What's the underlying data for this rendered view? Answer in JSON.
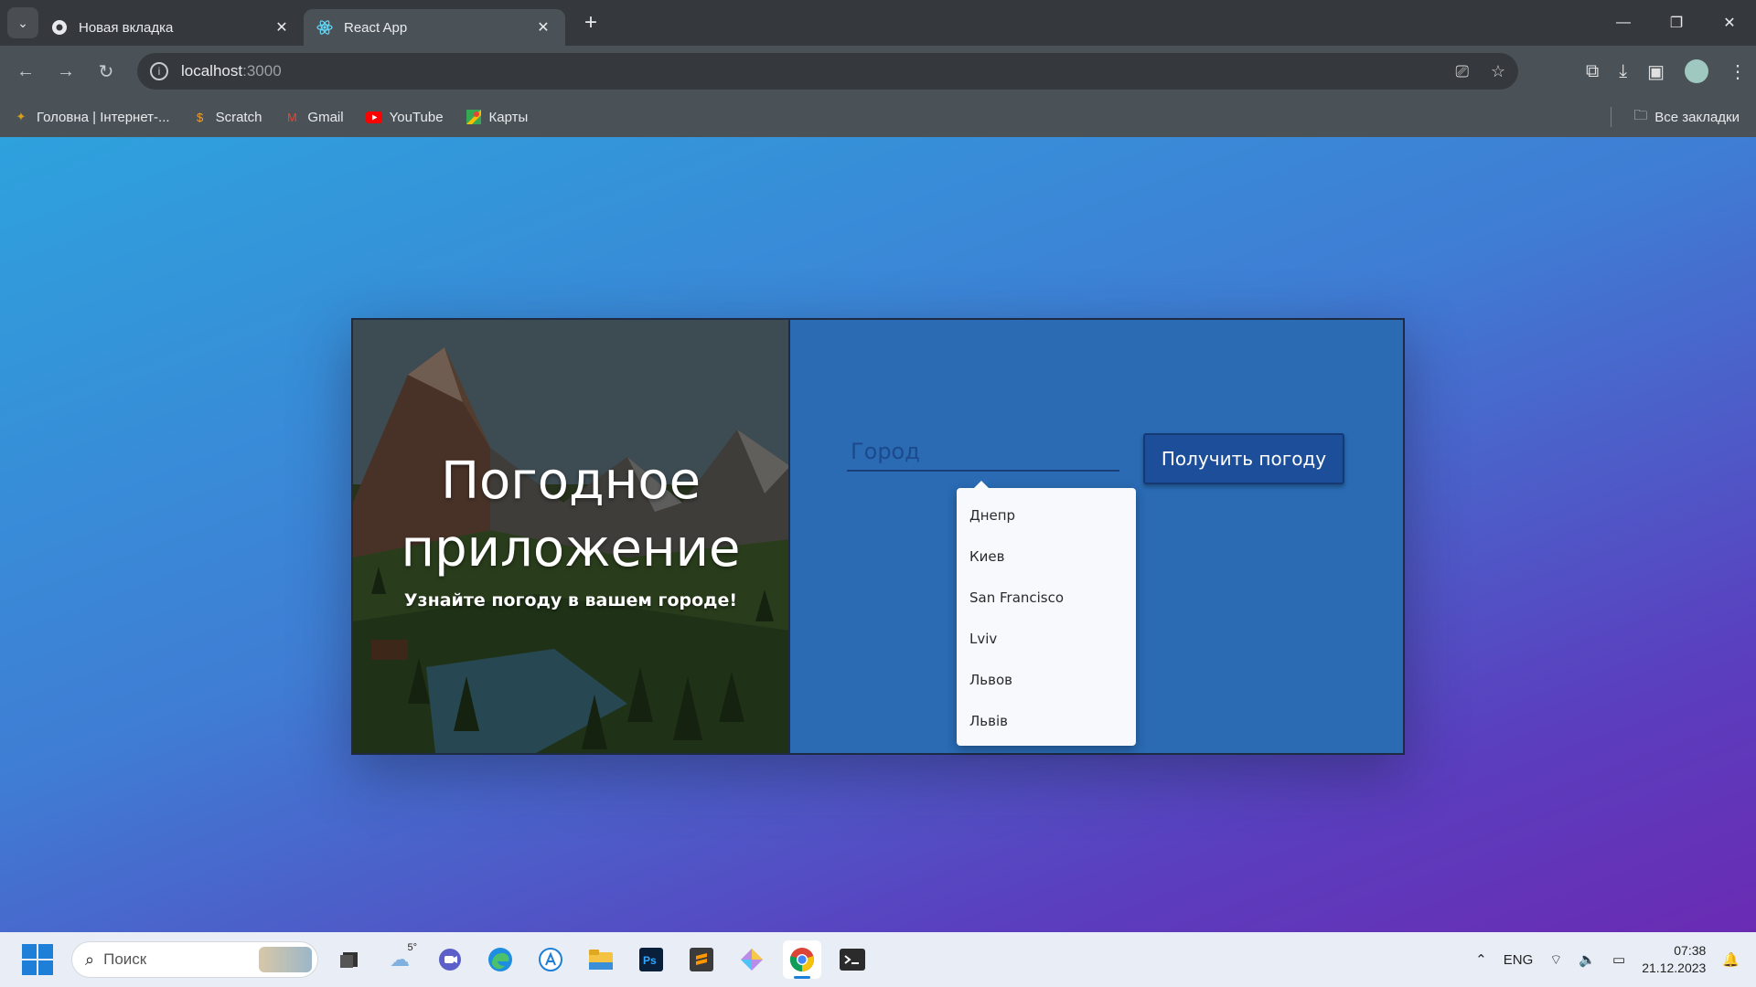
{
  "browser": {
    "tabs": [
      {
        "title": "Новая вкладка",
        "icon": "chrome-icon",
        "active": false
      },
      {
        "title": "React App",
        "icon": "react-icon",
        "active": true
      }
    ],
    "url_host": "localhost",
    "url_port": ":3000",
    "bookmarks": [
      {
        "label": "Головна | Інтернет-...",
        "icon": "bird-icon"
      },
      {
        "label": "Scratch",
        "icon": "scratch-icon"
      },
      {
        "label": "Gmail",
        "icon": "gmail-icon"
      },
      {
        "label": "YouTube",
        "icon": "youtube-icon"
      },
      {
        "label": "Карты",
        "icon": "maps-icon"
      }
    ],
    "all_bookmarks": "Все закладки"
  },
  "app": {
    "title_line1": "Погодное",
    "title_line2": "приложение",
    "subtitle": "Узнайте погоду в вашем городе!",
    "city_placeholder": "Город",
    "submit_label": "Получить погоду",
    "suggestions": [
      "Днепр",
      "Киев",
      "San Francisco",
      "Lviv",
      "Львов",
      "Львів"
    ]
  },
  "taskbar": {
    "search_placeholder": "Поиск",
    "weather_temp": "5°",
    "language": "ENG",
    "time": "07:38",
    "date": "21.12.2023"
  },
  "colors": {
    "card_right": "#2a6bb4",
    "button": "#1d4e9a",
    "gradient_start": "#2ea2dd",
    "gradient_end": "#6a2bb3"
  }
}
